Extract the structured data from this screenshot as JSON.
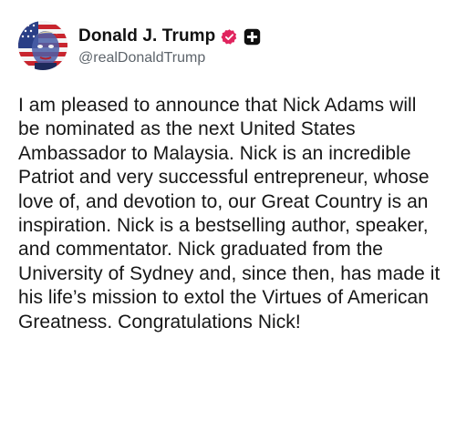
{
  "author": {
    "display_name": "Donald J. Trump",
    "handle": "@realDonaldTrump",
    "verified_icon": "verified-badge-icon",
    "plus_icon": "plus-badge-icon",
    "colors": {
      "verified": "#e0245e",
      "plus_bg": "#111111"
    }
  },
  "post": {
    "text": "I am pleased to announce that Nick Adams will be nominated as the next United States Ambassador to Malaysia. Nick is an incredible Patriot and very successful entrepreneur, whose love of, and devotion to, our Great Country is an inspiration. Nick is a bestselling author, speaker, and commentator. Nick graduated from the University of Sydney and, since then, has made it his life’s mission to extol the Virtues of American Greatness. Congratulations Nick!"
  }
}
